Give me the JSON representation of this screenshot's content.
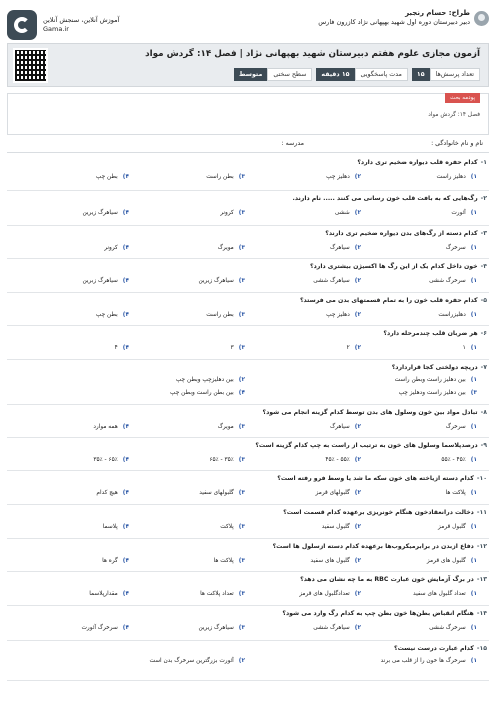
{
  "brand": {
    "line1": "آموزش آنلاین، سنجش آنلاین",
    "line2": "Gama.ir"
  },
  "author": {
    "name": "طراح: حسام رنجبر",
    "role": "دبیر دبیرستان دوره اول شهید بهپهانی نژاد کازرون فارس"
  },
  "title": "آزمون مجازی علوم هفتم دبیرستان شهید بهپهانی نژاد | فصل ۱۴: گردش مواد",
  "meta": {
    "count_label": "تعداد پرسش‌ها",
    "count_value": "۱۵",
    "time_label": "مدت پاسخگویی",
    "time_value": "۱۵ دقیقه",
    "level_label": "سطح سختی",
    "level_value": "متوسط"
  },
  "notice": {
    "tab": "پودمه بحث",
    "text": "فصل ۱۴: گردش مواد"
  },
  "student": {
    "name_label": "نام و نام خانوادگی :",
    "school_label": "مدرسه :"
  },
  "questions": [
    {
      "num": "۱-",
      "text": "کدام حفره قلب دیواره ضخیم تری دارد؟",
      "options": [
        "دهلیز راست",
        "دهلیز چپ",
        "بطن راست",
        "بطن چپ"
      ]
    },
    {
      "num": "۲-",
      "text": "رگ‌هایی که به بافت قلب خون رسانی می کنند ..... نام دارند.",
      "options": [
        "آئورت",
        "ششی",
        "کرونر",
        "سیاهرگ زیرین"
      ]
    },
    {
      "num": "۳-",
      "text": "کدام دسته از رگ‌های بدن دیواره ضخیم تری دارند؟",
      "options": [
        "سرخرگ",
        "سیاهرگ",
        "مویرگ",
        "کرونر"
      ]
    },
    {
      "num": "۴-",
      "text": "خون داخل کدام یک از این رگ ها اکسیژن بیشتری دارد؟",
      "options": [
        "سرخرگ ششی",
        "سیاهرگ ششی",
        "سیاهرگ زیرین",
        "سیاهرگ زبرین"
      ]
    },
    {
      "num": "۵-",
      "text": "کدام حفره قلب خون را به تمام قسمتهای بدن می فرستد؟",
      "options": [
        "دهلیزراست",
        "دهلیز چپ",
        "بطن راست",
        "بطن چپ"
      ]
    },
    {
      "num": "۶-",
      "text": "هر ضربان قلب چندمرحله دارد؟",
      "options": [
        "۱",
        "۲",
        "۳",
        "۴"
      ]
    },
    {
      "num": "۷-",
      "text": "دریچه دولختی کجا قراردارد؟",
      "options": [
        "بین دهلیز راست وبطن راست",
        "بین دهلیزچپ وبطن چپ",
        "بین دهلیز راست ودهلیز چپ",
        "بین بطن راست وبطن چپ"
      ]
    },
    {
      "num": "۸-",
      "text": "تبادل مواد بین خون وسلول های بدن توسط کدام گزینه انجام می شود؟",
      "options": [
        "سرخرگ",
        "سیاهرگ",
        "مویرگ",
        "همه موارد"
      ]
    },
    {
      "num": "۹-",
      "text": "درصدپلاسما وسلول های خون به ترتیب از راست به چپ کدام گزینه است؟",
      "options": [
        "۴۵٪ - ۵۵٪",
        "۵۵٪ - ۴۵٪",
        "۳۵٪ - ۶۵٪",
        "۶۵٪ - ۳۵٪"
      ]
    },
    {
      "num": "۱۰-",
      "text": "کدام دسته ازیاخته های خون سکه ما شد یا وسط فرو رفته است؟",
      "options": [
        "پلاکت ها",
        "گلبولهای قرمز",
        "گلبولهای سفید",
        "هیچ کدام"
      ]
    },
    {
      "num": "۱۱-",
      "text": "دخالت درانعقادخون هنگام خونریزی برعهده کدام قسمت است؟",
      "options": [
        "گلبول قرمز",
        "گلبول سفید",
        "پلاکت",
        "پلاسما"
      ]
    },
    {
      "num": "۱۲-",
      "text": "دفاع ازبدن در برابرمیکروب‌ها برعهده کدام دسته ازسلول ها است؟",
      "options": [
        "گلبول های قرمز",
        "گلبول های سفید",
        "پلاکت ها",
        "گره ها"
      ]
    },
    {
      "num": "۱۳-",
      "text": "در برگ آزمایش خون عبارت RBC به ما چه نشان می دهد؟",
      "options": [
        "تعداد گلبول های سفید",
        "تعدادگلبول های قرمز",
        "تعداد پلاکت ها",
        "مقدارپلاسما"
      ]
    },
    {
      "num": "۱۴-",
      "text": "هنگام انقباض بطن‌ها خون بطن چپ به کدام رگ وارد می شود؟",
      "options": [
        "سرخرگ ششی",
        "سیاهرگ ششی",
        "سیاهرگ زیرین",
        "سرخرگ آئورت"
      ]
    },
    {
      "num": "۱۵-",
      "text": "کدام عبارت درست نیست؟",
      "options": [
        "سرخرگ ها خون را از قلب می برند",
        "آئورت بزرگترین سرخرگ بدن است"
      ]
    }
  ]
}
